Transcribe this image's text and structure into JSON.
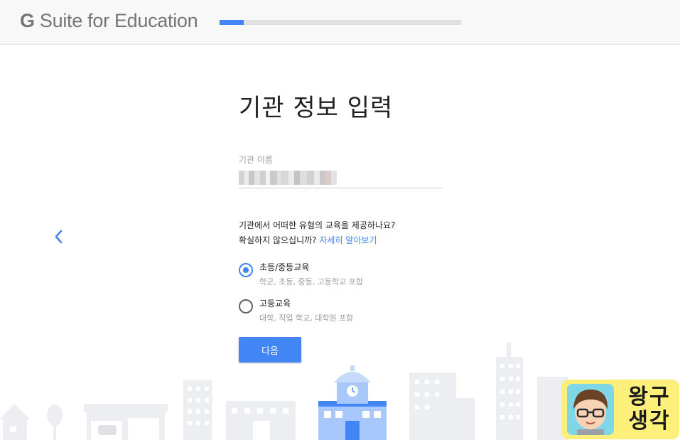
{
  "header": {
    "logo_g": "G",
    "logo_rest": " Suite for Education",
    "progress_fraction": 0.1
  },
  "form": {
    "title": "기관 정보 입력",
    "org_name_label": "기관 이름",
    "org_name_value": "",
    "question_line1": "기관에서 어떠한 유형의 교육을 제공하나요?",
    "question_line2": "확실하지 않으십니까? ",
    "learn_more_link": "자세히 알아보기",
    "options": [
      {
        "title": "초등/중등교육",
        "description": "학군, 초등, 중등, 고등학교 포함",
        "selected": true
      },
      {
        "title": "고등교육",
        "description": "대학, 직업 학교, 대학원 포함",
        "selected": false
      }
    ],
    "next_button": "다음"
  },
  "navigation": {
    "back_icon": "chevron-left-icon"
  },
  "watermark": {
    "line1": "왕구",
    "line2": "생각"
  },
  "colors": {
    "accent": "#4285f4",
    "header_bg": "#f8f8f8",
    "progress_track": "#e0e0e0",
    "skyline_gray": "#e8eaed",
    "school_blue": "#4285f4",
    "watermark_bg": "#fdf07a"
  }
}
